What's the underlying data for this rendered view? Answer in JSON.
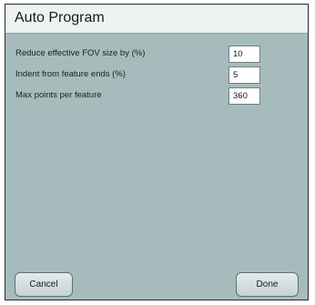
{
  "dialog": {
    "title": "Auto Program",
    "fields": [
      {
        "label": "Reduce effective FOV size by (%)",
        "value": "10"
      },
      {
        "label": "Indent from feature ends (%)",
        "value": "5"
      },
      {
        "label": "Max points per feature",
        "value": "360"
      }
    ],
    "buttons": {
      "cancel_label": "Cancel",
      "done_label": "Done"
    }
  },
  "colors": {
    "panel_background": "#a6bcbc",
    "title_background": "#edf2f2"
  }
}
